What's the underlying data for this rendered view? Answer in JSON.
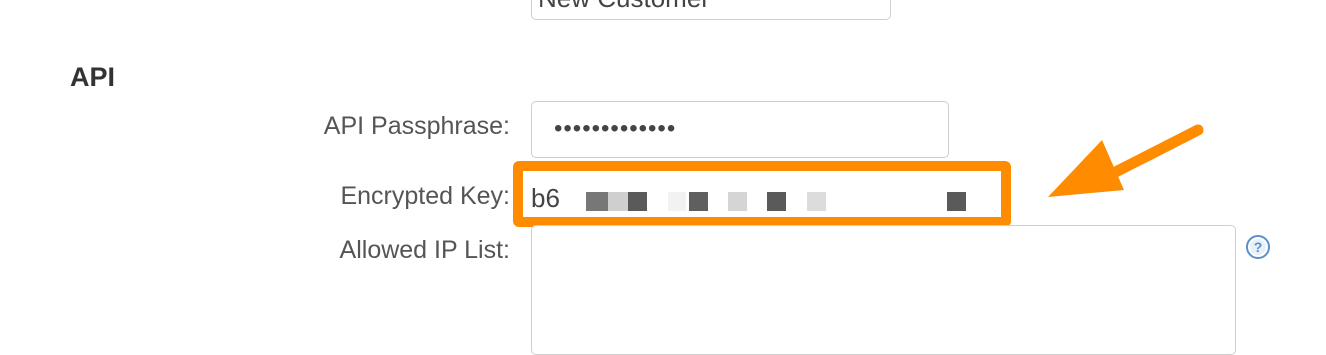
{
  "form": {
    "top_field_value": "New Customer"
  },
  "api_section": {
    "heading": "API",
    "passphrase_label": "API Passphrase:",
    "passphrase_value": "•••••••••••••",
    "encrypted_key_label": "Encrypted Key:",
    "encrypted_key_visible": "b6",
    "allowed_ip_label": "Allowed IP List:",
    "allowed_ip_value": ""
  },
  "icons": {
    "help": "help-question-icon",
    "annotation": "orange-arrow-icon"
  },
  "colors": {
    "highlight": "#ff8c00",
    "help_icon": "#5b8fc7"
  }
}
